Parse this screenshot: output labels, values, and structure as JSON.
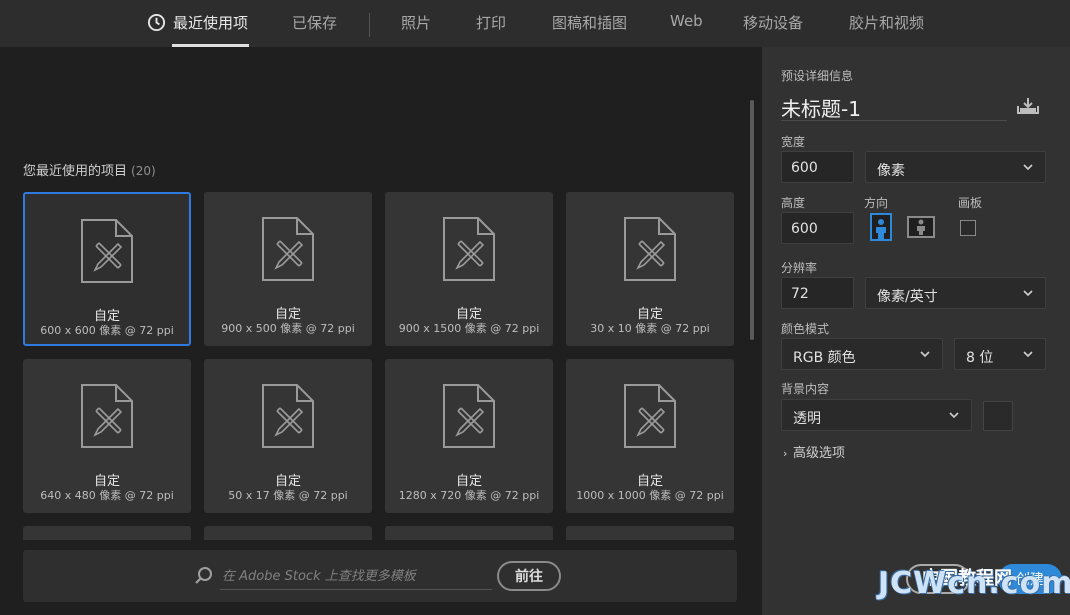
{
  "tabs": [
    {
      "label": "最近使用项",
      "active": true
    },
    {
      "label": "已保存",
      "active": false
    },
    {
      "label": "照片",
      "active": false
    },
    {
      "label": "打印",
      "active": false
    },
    {
      "label": "图稿和插图",
      "active": false
    },
    {
      "label": "Web",
      "active": false
    },
    {
      "label": "移动设备",
      "active": false
    },
    {
      "label": "胶片和视频",
      "active": false
    }
  ],
  "recent": {
    "title": "您最近使用的项目",
    "count": "(20)",
    "items": [
      {
        "name": "自定",
        "detail": "600 x 600 像素 @ 72 ppi",
        "selected": true
      },
      {
        "name": "自定",
        "detail": "900 x 500 像素 @ 72 ppi"
      },
      {
        "name": "自定",
        "detail": "900 x 1500 像素 @ 72 ppi"
      },
      {
        "name": "自定",
        "detail": "30 x 10 像素 @ 72 ppi"
      },
      {
        "name": "自定",
        "detail": "640 x 480 像素 @ 72 ppi"
      },
      {
        "name": "自定",
        "detail": "50 x 17 像素 @ 72 ppi"
      },
      {
        "name": "自定",
        "detail": "1280 x 720 像素 @ 72 ppi"
      },
      {
        "name": "自定",
        "detail": "1000 x 1000 像素 @ 72 ppi"
      }
    ]
  },
  "stock": {
    "placeholder": "在 Adobe Stock 上查找更多模板",
    "go_label": "前往"
  },
  "preset": {
    "heading": "预设详细信息",
    "name": "未标题-1",
    "width_label": "宽度",
    "width_value": "600",
    "width_unit": "像素",
    "height_label": "高度",
    "height_value": "600",
    "orientation_label": "方向",
    "artboard_label": "画板",
    "resolution_label": "分辨率",
    "resolution_value": "72",
    "resolution_unit": "像素/英寸",
    "color_mode_label": "颜色模式",
    "color_mode_value": "RGB 颜色",
    "bit_depth_value": "8 位",
    "background_label": "背景内容",
    "background_value": "透明",
    "advanced_label": "高级选项",
    "close_label": "关闭",
    "create_label": "创建"
  },
  "watermark": {
    "line1": "中国教程网",
    "line2": "JCWcn.com"
  },
  "colors": {
    "accent": "#2e7ae0",
    "panel": "#323232",
    "content": "#1f1f1f"
  }
}
